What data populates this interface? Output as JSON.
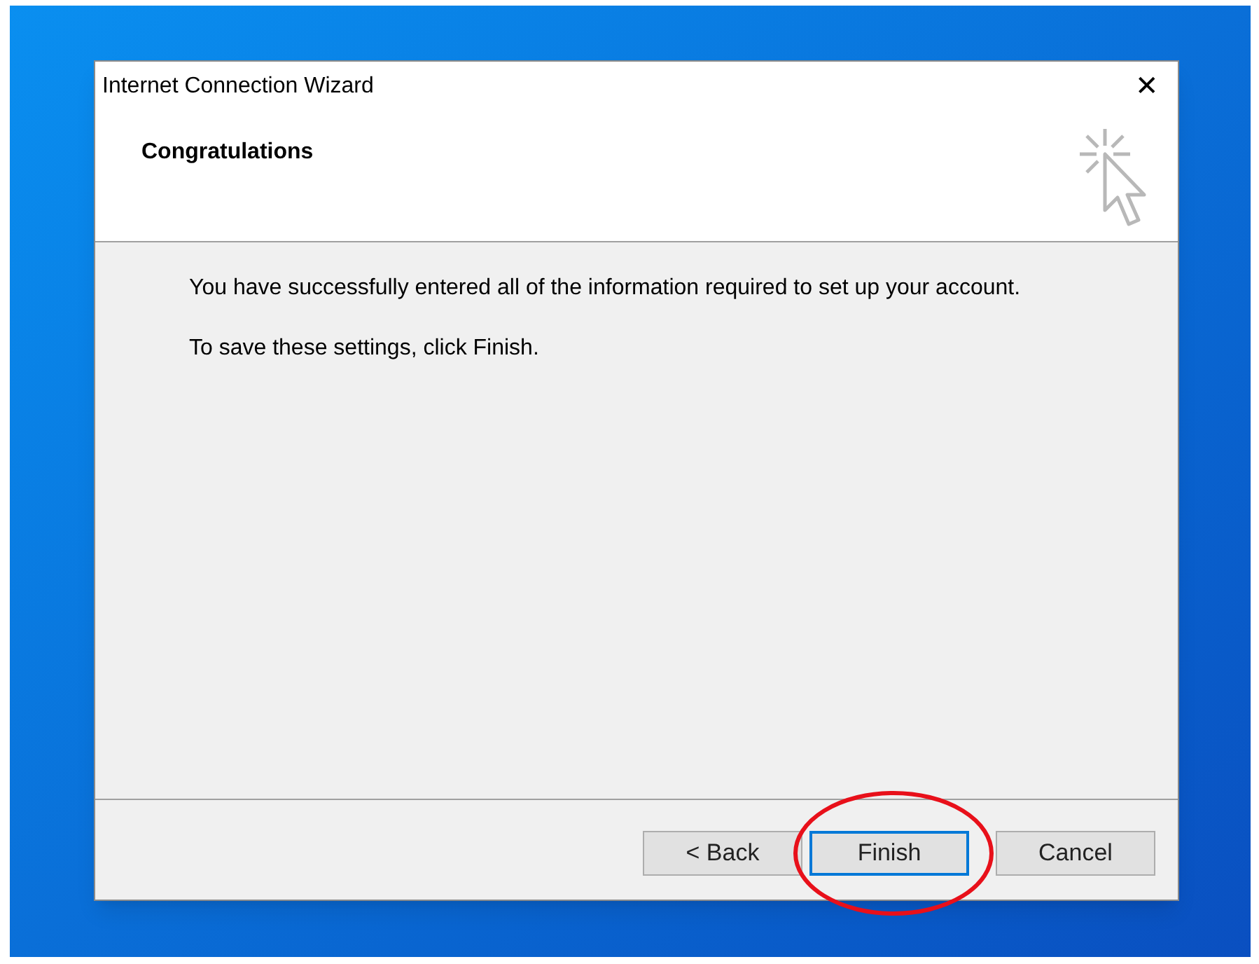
{
  "window": {
    "title": "Internet Connection Wizard",
    "close": "✕"
  },
  "header": {
    "title": "Congratulations"
  },
  "body": {
    "paragraphs": [
      "You have successfully entered all of the information required to set up your account.",
      "To save these settings, click Finish."
    ]
  },
  "buttons": [
    {
      "label": "< Back",
      "default": false,
      "circled": false
    },
    {
      "label": "Finish",
      "default": true,
      "circled": true
    },
    {
      "label": "Cancel",
      "default": false,
      "circled": false
    }
  ]
}
